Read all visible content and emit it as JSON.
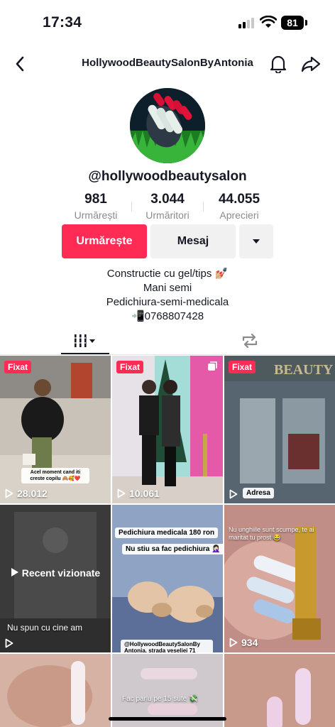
{
  "status": {
    "time": "17:34",
    "battery": "81"
  },
  "header": {
    "title": "HollywoodBeautySalonByAntonia"
  },
  "profile": {
    "handle": "@hollywoodbeautysalon",
    "stats": [
      {
        "value": "981",
        "label": "Urmărești"
      },
      {
        "value": "3.044",
        "label": "Urmăritori"
      },
      {
        "value": "44.055",
        "label": "Aprecieri"
      }
    ],
    "follow_label": "Urmărește",
    "message_label": "Mesaj",
    "bio": [
      "Constructie cu gel/tips 💅🏼",
      "Mani semi",
      "Pedichiura-semi-medicala",
      "📲0768807428"
    ]
  },
  "grid": {
    "pinned_label": "Fixat",
    "videos": [
      {
        "views": "28.012",
        "pinned": true,
        "caption": "Acel moment cand iti creste copilu 🙈🥰❤️"
      },
      {
        "views": "10.061",
        "pinned": true,
        "caption": ""
      },
      {
        "views": "",
        "pinned": true,
        "caption": "Adresa"
      },
      {
        "views": "",
        "pinned": false,
        "caption": "Nu spun cu cine am",
        "overlay": "Recent vizionate"
      },
      {
        "views": "",
        "pinned": false,
        "caption": "Pedichiura medicala 180 ron",
        "caption2": "Nu stiu sa fac pedichiura 🤦🏻‍♀️",
        "caption3": "@HollywoodBeautySalonBy Antonia, strada veseliei 71"
      },
      {
        "views": "934",
        "pinned": false,
        "caption": "Nu unghiile sunt scumpe, te ai maritat tu prost 😂"
      },
      {
        "views": "",
        "pinned": false,
        "caption": ""
      },
      {
        "views": "",
        "pinned": false,
        "caption": "Fac parlu pe 15 sute 💸"
      },
      {
        "views": "",
        "pinned": false,
        "caption": ""
      }
    ]
  },
  "colors": {
    "accent": "#fe2c55",
    "text": "#161823",
    "muted": "#8a8b91"
  }
}
